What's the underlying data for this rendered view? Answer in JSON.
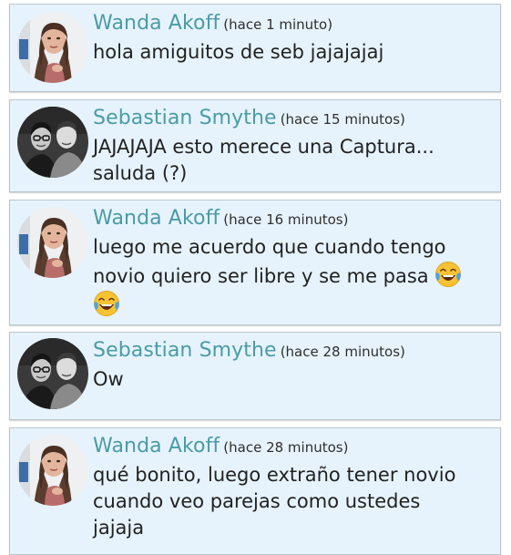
{
  "comments": [
    {
      "author": "Wanda Akoff",
      "time": "(hace 1 minuto)",
      "lines": [
        "hola amiguitos de seb jajajajaj"
      ],
      "avatar_icon": "wanda-avatar-icon"
    },
    {
      "author": "Sebastian Smythe",
      "time": "(hace 15 minutos)",
      "lines": [
        "JAJAJAJA esto merece una Captura...",
        "saluda (?)"
      ],
      "avatar_icon": "sebastian-avatar-icon"
    },
    {
      "author": "Wanda Akoff",
      "time": "(hace 16 minutos)",
      "lines": [
        "luego me acuerdo que cuando tengo",
        "novio quiero ser libre y se me pasa"
      ],
      "emoji": "face-with-tears-of-joy-icon",
      "avatar_icon": "wanda-avatar-icon"
    },
    {
      "author": "Sebastian Smythe",
      "time": "(hace 28 minutos)",
      "lines": [
        "Ow"
      ],
      "avatar_icon": "sebastian-avatar-icon"
    },
    {
      "author": "Wanda Akoff",
      "time": "(hace 28 minutos)",
      "lines": [
        "qué bonito, luego extraño tener novio",
        "cuando veo parejas como ustedes",
        "jajaja"
      ],
      "avatar_icon": "wanda-avatar-icon"
    }
  ],
  "colors": {
    "card_background": "#e6f3fc",
    "author_name": "#4a9ba7",
    "message_text": "#222222"
  }
}
